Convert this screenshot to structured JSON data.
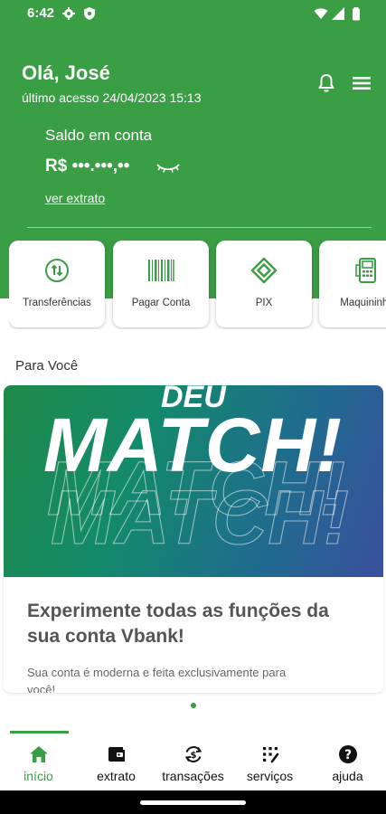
{
  "status_bar": {
    "time": "6:42"
  },
  "header": {
    "greeting": "Olá, José",
    "last_access": "último acesso 24/04/2023  15:13"
  },
  "balance": {
    "label": "Saldo em conta",
    "masked_value": "R$ •••.•••,••",
    "statement_link": "ver extrato"
  },
  "quick_actions": [
    {
      "label": "Transferências",
      "icon": "transfer-icon"
    },
    {
      "label": "Pagar Conta",
      "icon": "barcode-icon"
    },
    {
      "label": "PIX",
      "icon": "pix-icon"
    },
    {
      "label": "Maquininha",
      "icon": "card-machine-icon"
    }
  ],
  "for_you": {
    "title": "Para Você",
    "banner": {
      "small_text": "DEU",
      "big_text": "MATCH!",
      "headline": "Experimente todas as funções da sua conta Vbank!",
      "description": "Sua conta é moderna e feita exclusivamente para você!"
    }
  },
  "bottom_nav": [
    {
      "label": "início",
      "icon": "home-icon",
      "active": true
    },
    {
      "label": "extrato",
      "icon": "wallet-icon",
      "active": false
    },
    {
      "label": "transações",
      "icon": "transactions-icon",
      "active": false
    },
    {
      "label": "serviços",
      "icon": "services-icon",
      "active": false
    },
    {
      "label": "ajuda",
      "icon": "help-icon",
      "active": false
    }
  ],
  "colors": {
    "brand_green": "#3a9e45",
    "text_dark": "#333333"
  }
}
